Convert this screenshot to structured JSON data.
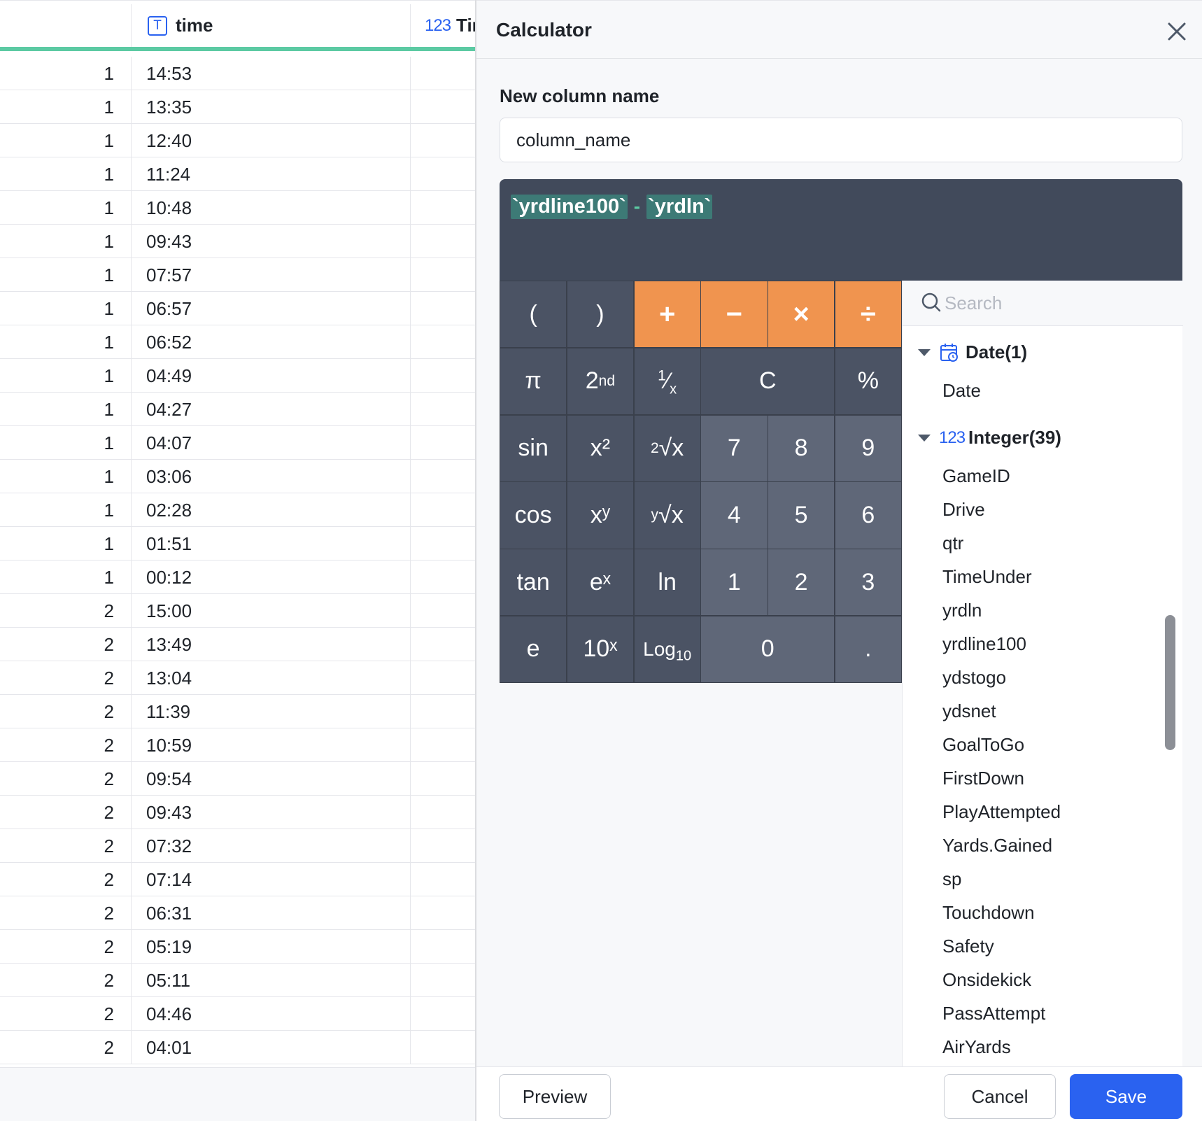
{
  "table": {
    "headers": [
      {
        "label": ""
      },
      {
        "label": "time",
        "type_icon": "text-type-icon"
      },
      {
        "label": "Tir",
        "type_icon": "123"
      }
    ],
    "rows": [
      {
        "num": "1",
        "time": "14:53"
      },
      {
        "num": "1",
        "time": "13:35"
      },
      {
        "num": "1",
        "time": "12:40"
      },
      {
        "num": "1",
        "time": "11:24"
      },
      {
        "num": "1",
        "time": "10:48"
      },
      {
        "num": "1",
        "time": "09:43"
      },
      {
        "num": "1",
        "time": "07:57"
      },
      {
        "num": "1",
        "time": "06:57"
      },
      {
        "num": "1",
        "time": "06:52"
      },
      {
        "num": "1",
        "time": "04:49"
      },
      {
        "num": "1",
        "time": "04:27"
      },
      {
        "num": "1",
        "time": "04:07"
      },
      {
        "num": "1",
        "time": "03:06"
      },
      {
        "num": "1",
        "time": "02:28"
      },
      {
        "num": "1",
        "time": "01:51"
      },
      {
        "num": "1",
        "time": "00:12"
      },
      {
        "num": "2",
        "time": "15:00"
      },
      {
        "num": "2",
        "time": "13:49"
      },
      {
        "num": "2",
        "time": "13:04"
      },
      {
        "num": "2",
        "time": "11:39"
      },
      {
        "num": "2",
        "time": "10:59"
      },
      {
        "num": "2",
        "time": "09:54"
      },
      {
        "num": "2",
        "time": "09:43"
      },
      {
        "num": "2",
        "time": "07:32"
      },
      {
        "num": "2",
        "time": "07:14"
      },
      {
        "num": "2",
        "time": "06:31"
      },
      {
        "num": "2",
        "time": "05:19"
      },
      {
        "num": "2",
        "time": "05:11"
      },
      {
        "num": "2",
        "time": "04:46"
      },
      {
        "num": "2",
        "time": "04:01"
      }
    ]
  },
  "dialog": {
    "title": "Calculator",
    "close_icon": "close-icon",
    "column_name_label": "New column name",
    "column_name_value": "column_name",
    "expression": {
      "left": "`yrdline100`",
      "operator": "-",
      "right": "`yrdln`"
    },
    "keypad": {
      "row1": [
        "(",
        ")",
        "+",
        "−",
        "×",
        "÷"
      ],
      "row2": [
        "π",
        "2nd",
        "1/x",
        "C",
        "%"
      ],
      "row3": [
        "sin",
        "x²",
        "2√x",
        "7",
        "8",
        "9"
      ],
      "row4": [
        "cos",
        "xʸ",
        "y√x",
        "4",
        "5",
        "6"
      ],
      "row5": [
        "tan",
        "eˣ",
        "ln",
        "1",
        "2",
        "3"
      ],
      "row6": [
        "e",
        "10ˣ",
        "Log10",
        "0",
        "."
      ]
    },
    "search_placeholder": "Search",
    "groups": [
      {
        "label": "Date(1)",
        "icon": "calendar-icon",
        "fields": [
          "Date"
        ]
      },
      {
        "label": "Integer(39)",
        "icon": "123",
        "fields": [
          "GameID",
          "Drive",
          "qtr",
          "TimeUnder",
          "yrdln",
          "yrdline100",
          "ydstogo",
          "ydsnet",
          "GoalToGo",
          "FirstDown",
          "PlayAttempted",
          "Yards.Gained",
          "sp",
          "Touchdown",
          "Safety",
          "Onsidekick",
          "PassAttempt",
          "AirYards"
        ]
      }
    ],
    "footer": {
      "preview_label": "Preview",
      "cancel_label": "Cancel",
      "save_label": "Save"
    },
    "colors": {
      "accent": "#2a62f0",
      "operator_key": "#f0944f",
      "expression_bg": "#414a5b",
      "header_underline": "#5ccaa3"
    }
  }
}
